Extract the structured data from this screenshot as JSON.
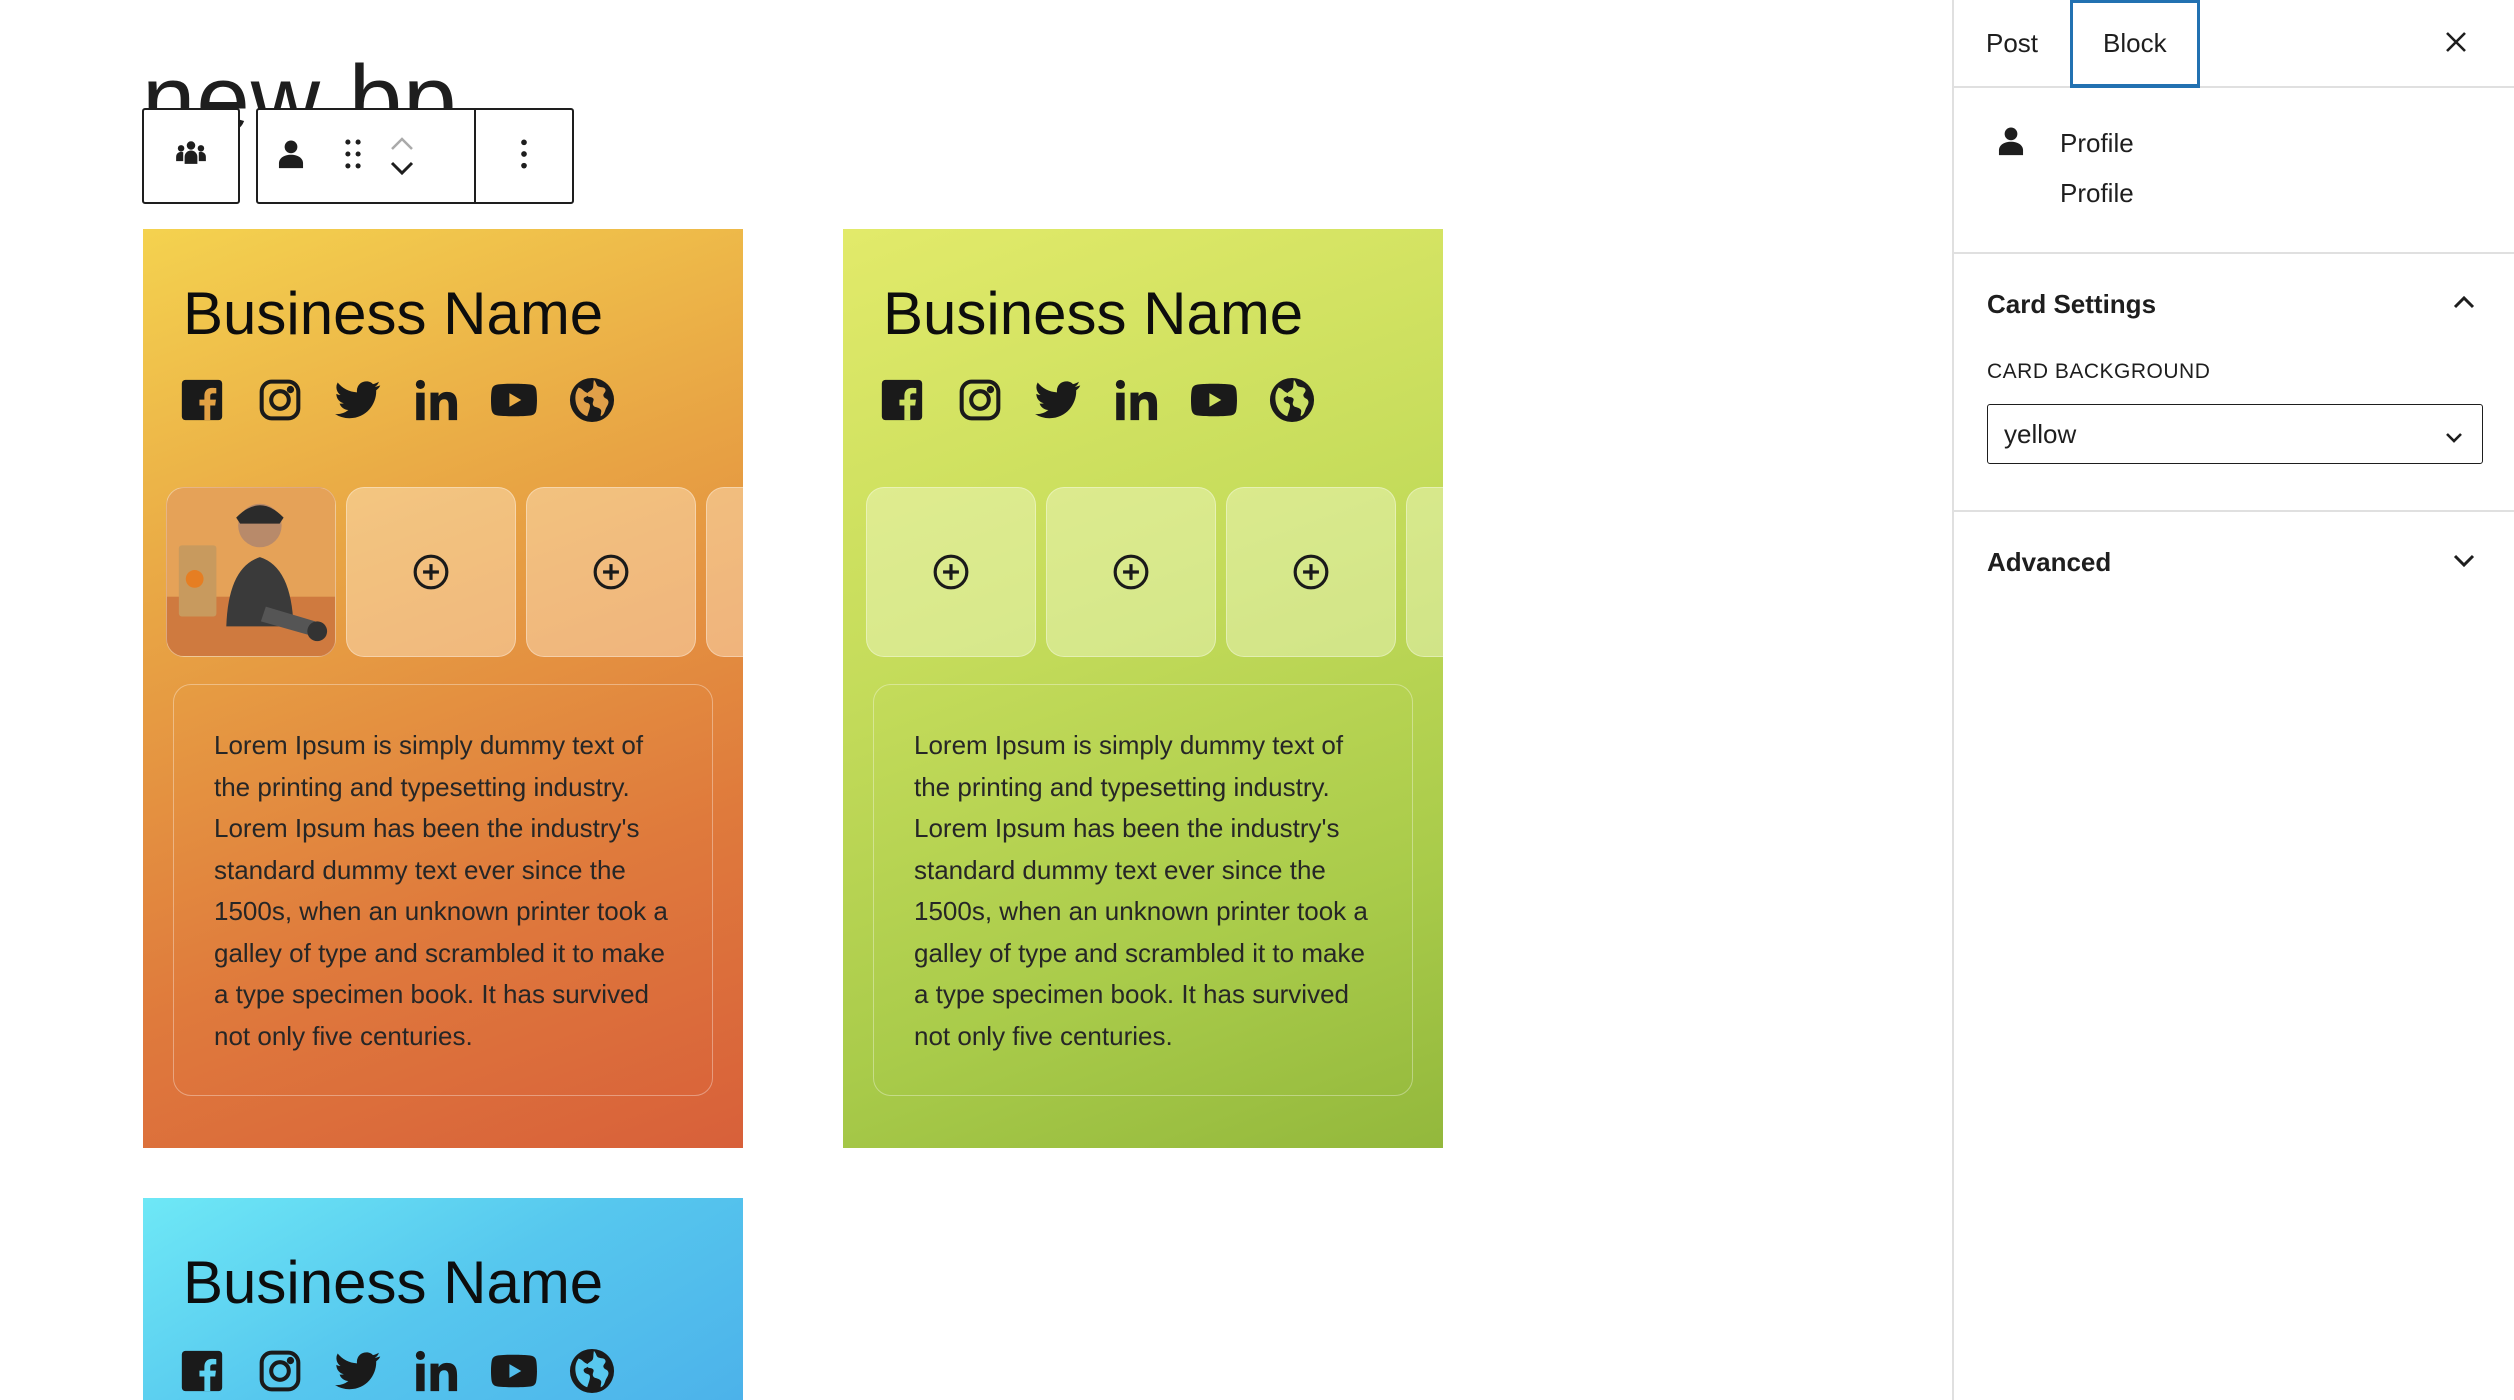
{
  "page": {
    "title": "new bp"
  },
  "toolbar": {
    "parent_block_icon": "group-people-icon",
    "block_icon": "person-icon",
    "drag_icon": "drag-handle-icon",
    "move_up_icon": "chevron-up-icon",
    "move_down_icon": "chevron-down-icon",
    "options_icon": "more-vertical-icon"
  },
  "cards": [
    {
      "background": "yellow",
      "business_name": "Business Name",
      "socials": [
        "facebook-icon",
        "instagram-icon",
        "twitter-icon",
        "linkedin-icon",
        "youtube-icon",
        "globe-icon"
      ],
      "description": "Lorem Ipsum is simply dummy text of the printing and typesetting industry. Lorem Ipsum has been the industry's standard dummy text ever since the 1500s, when an unknown printer took a galley of type and scrambled it to make a type specimen book. It has survived not only five centuries."
    },
    {
      "background": "green",
      "business_name": "Business Name",
      "socials": [
        "facebook-icon",
        "instagram-icon",
        "twitter-icon",
        "linkedin-icon",
        "youtube-icon",
        "globe-icon"
      ],
      "description": "Lorem Ipsum is simply dummy text of the printing and typesetting industry. Lorem Ipsum has been the industry's standard dummy text ever since the 1500s, when an unknown printer took a galley of type and scrambled it to make a type specimen book. It has survived not only five centuries."
    },
    {
      "background": "blue",
      "business_name": "Business Name",
      "socials": [
        "facebook-icon",
        "instagram-icon",
        "twitter-icon",
        "linkedin-icon",
        "youtube-icon",
        "globe-icon"
      ]
    }
  ],
  "sidebar": {
    "tabs": [
      {
        "label": "Post",
        "active": false
      },
      {
        "label": "Block",
        "active": true
      }
    ],
    "close_icon": "close-icon",
    "block": {
      "title": "Profile",
      "description": "Profile",
      "icon": "person-icon"
    },
    "card_settings": {
      "title": "Card Settings",
      "expanded": true,
      "background_label": "CARD BACKGROUND",
      "background_value": "yellow"
    },
    "advanced": {
      "title": "Advanced",
      "expanded": false
    }
  },
  "colors": {
    "accent": "#2271b1",
    "border": "#e0e0e0",
    "text": "#1e1e1e"
  }
}
